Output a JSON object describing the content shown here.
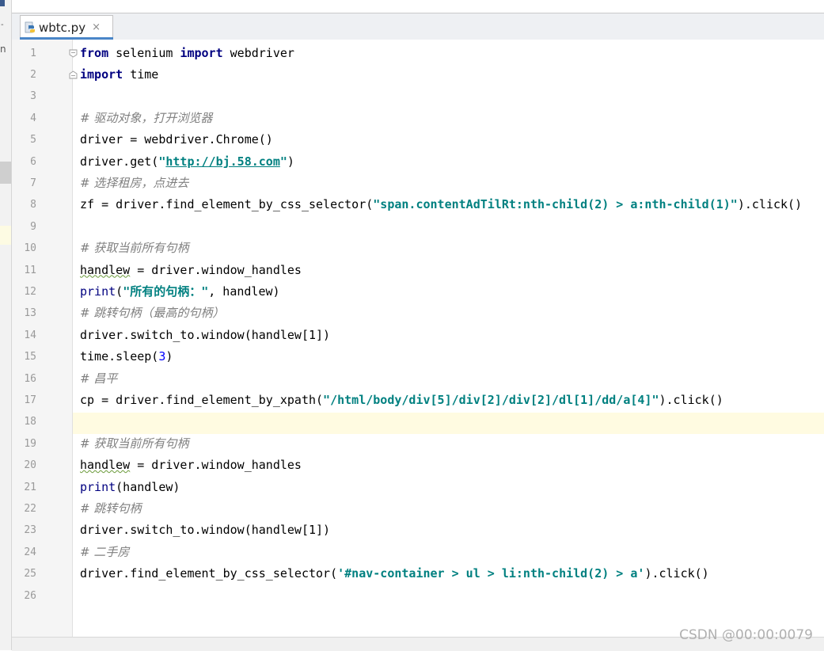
{
  "tab": {
    "filename": "wbtc.py",
    "close_glyph": "×",
    "icon": "python-file-icon"
  },
  "left_strip": {
    "dash": "-",
    "letter": "n"
  },
  "editor": {
    "current_line": 18,
    "lines": [
      {
        "n": "1",
        "segs": [
          {
            "t": "from",
            "c": "kw"
          },
          {
            "t": " selenium "
          },
          {
            "t": "import",
            "c": "kw"
          },
          {
            "t": " webdriver"
          }
        ]
      },
      {
        "n": "2",
        "segs": [
          {
            "t": "import",
            "c": "kw"
          },
          {
            "t": " time"
          }
        ]
      },
      {
        "n": "3",
        "segs": []
      },
      {
        "n": "4",
        "segs": [
          {
            "t": "# 驱动对象，打开浏览器",
            "c": "cm"
          }
        ]
      },
      {
        "n": "5",
        "segs": [
          {
            "t": "driver = webdriver.Chrome()"
          }
        ]
      },
      {
        "n": "6",
        "segs": [
          {
            "t": "driver.get("
          },
          {
            "t": "\"",
            "c": "str"
          },
          {
            "t": "http://bj.58.com",
            "c": "url"
          },
          {
            "t": "\"",
            "c": "str"
          },
          {
            "t": ")"
          }
        ]
      },
      {
        "n": "7",
        "segs": [
          {
            "t": "# 选择租房，点进去",
            "c": "cm"
          }
        ]
      },
      {
        "n": "8",
        "segs": [
          {
            "t": "zf = driver.find_element_by_css_selector("
          },
          {
            "t": "\"span.contentAdTilRt:nth-child(2) > a:nth-child(1)\"",
            "c": "str"
          },
          {
            "t": ").click()"
          }
        ]
      },
      {
        "n": "9",
        "segs": []
      },
      {
        "n": "10",
        "segs": [
          {
            "t": "# 获取当前所有句柄",
            "c": "cm"
          }
        ]
      },
      {
        "n": "11",
        "segs": [
          {
            "t": "handlew",
            "c": "squig"
          },
          {
            "t": " = driver.window_handles"
          }
        ]
      },
      {
        "n": "12",
        "segs": [
          {
            "t": "print",
            "c": "bi"
          },
          {
            "t": "("
          },
          {
            "t": "\"所有的句柄：\"",
            "c": "str"
          },
          {
            "t": ", handlew)"
          }
        ]
      },
      {
        "n": "13",
        "segs": [
          {
            "t": "# 跳转句柄（最高的句柄）",
            "c": "cm"
          }
        ]
      },
      {
        "n": "14",
        "segs": [
          {
            "t": "driver.switch_to.window(handlew[1])"
          }
        ]
      },
      {
        "n": "15",
        "segs": [
          {
            "t": "time.sleep("
          },
          {
            "t": "3",
            "c": "num"
          },
          {
            "t": ")"
          }
        ]
      },
      {
        "n": "16",
        "segs": [
          {
            "t": "# 昌平",
            "c": "cm"
          }
        ]
      },
      {
        "n": "17",
        "segs": [
          {
            "t": "cp = driver.find_element_by_xpath("
          },
          {
            "t": "\"/html/body/div[5]/div[2]/div[2]/dl[1]/dd/a[4]\"",
            "c": "str"
          },
          {
            "t": ").click()"
          }
        ]
      },
      {
        "n": "18",
        "segs": []
      },
      {
        "n": "19",
        "segs": [
          {
            "t": "# 获取当前所有句柄",
            "c": "cm"
          }
        ]
      },
      {
        "n": "20",
        "segs": [
          {
            "t": "handlew",
            "c": "squig"
          },
          {
            "t": " = driver.window_handles"
          }
        ]
      },
      {
        "n": "21",
        "segs": [
          {
            "t": "print",
            "c": "bi"
          },
          {
            "t": "(handlew)"
          }
        ]
      },
      {
        "n": "22",
        "segs": [
          {
            "t": "# 跳转句柄",
            "c": "cm"
          }
        ]
      },
      {
        "n": "23",
        "segs": [
          {
            "t": "driver.switch_to.window(handlew[1])"
          }
        ]
      },
      {
        "n": "24",
        "segs": [
          {
            "t": "# 二手房",
            "c": "cm"
          }
        ]
      },
      {
        "n": "25",
        "segs": [
          {
            "t": "driver.find_element_by_css_selector("
          },
          {
            "t": "'#nav-container > ul > li:nth-child(2) > a'",
            "c": "str"
          },
          {
            "t": ").click()"
          }
        ]
      },
      {
        "n": "26",
        "segs": []
      }
    ]
  },
  "watermark": "CSDN @00:00:0079",
  "colors": {
    "keyword": "#000080",
    "comment": "#808080",
    "string": "#008080",
    "number": "#0000ff",
    "current_line": "#fffbe1",
    "tab_accent": "#4a86c8"
  }
}
